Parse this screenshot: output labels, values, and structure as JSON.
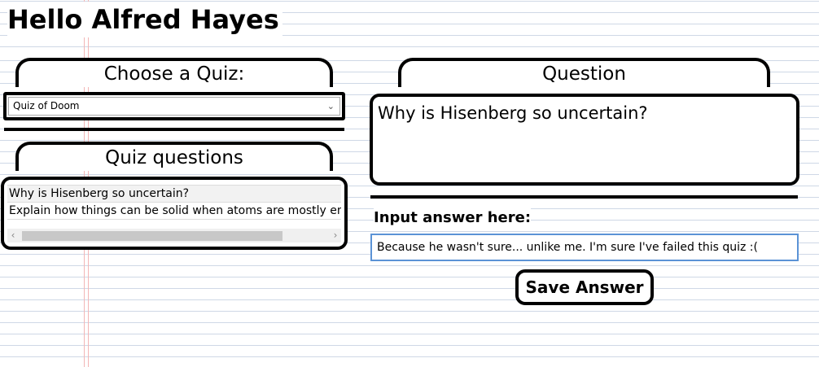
{
  "greeting": "Hello Alfred Hayes",
  "quiz_picker": {
    "header": "Choose a Quiz:",
    "selected": "Quiz of Doom",
    "chevron_icon": "chevron-down-icon"
  },
  "quiz_questions": {
    "header": "Quiz questions",
    "items": [
      "Why is Hisenberg so uncertain?",
      "Explain how things can be solid when atoms are mostly empty space"
    ]
  },
  "question_panel": {
    "header": "Question",
    "text": "Why is Hisenberg so uncertain?"
  },
  "answer": {
    "label": "Input answer here:",
    "value": "Because he wasn't sure... unlike me. I'm sure I've failed this quiz :("
  },
  "save_button": "Save Answer",
  "colors": {
    "input_border": "#5b93d6",
    "ruled_line": "#cfd8e6",
    "margin_line": "#f3b6b6"
  }
}
